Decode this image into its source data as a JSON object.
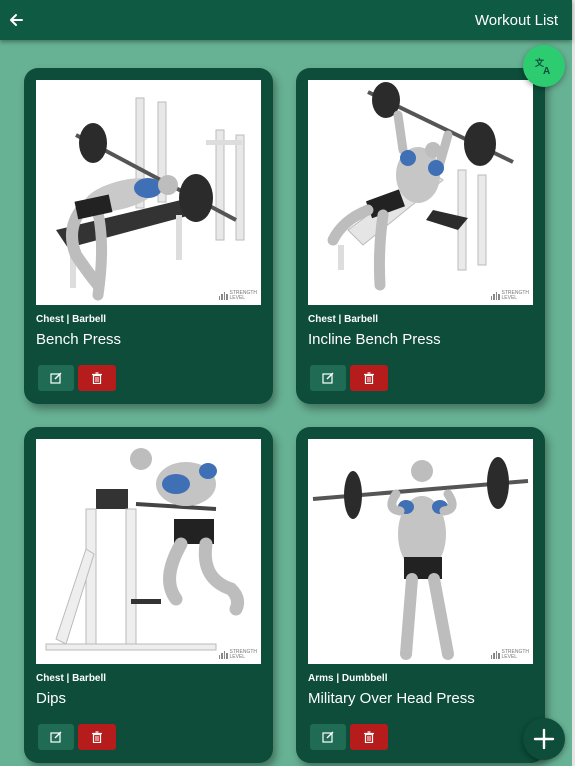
{
  "appbar": {
    "title": "Workout List",
    "back_icon": "arrow-left-icon",
    "background": "#0f5a43"
  },
  "fabs": {
    "translate_icon": "translate-icon",
    "translate_color": "#2ecc71",
    "add_icon": "plus-icon",
    "add_color": "#0d4d3a"
  },
  "workouts": [
    {
      "category": "Chest | Barbell",
      "name": "Bench Press",
      "watermark": [
        "STRENGTH",
        "LEVEL"
      ]
    },
    {
      "category": "Chest | Barbell",
      "name": "Incline Bench Press",
      "watermark": [
        "STRENGTH",
        "LEVEL"
      ]
    },
    {
      "category": "Chest | Barbell",
      "name": "Dips",
      "watermark": [
        "STRENGTH",
        "LEVEL"
      ]
    },
    {
      "category": "Arms | Dumbbell",
      "name": "Military Over Head Press",
      "watermark": [
        "STRENGTH",
        "LEVEL"
      ]
    }
  ],
  "colors": {
    "background": "#67b194",
    "card": "#0d4d3a",
    "edit_button": "#1f6b54",
    "delete_button": "#b71c1c"
  }
}
